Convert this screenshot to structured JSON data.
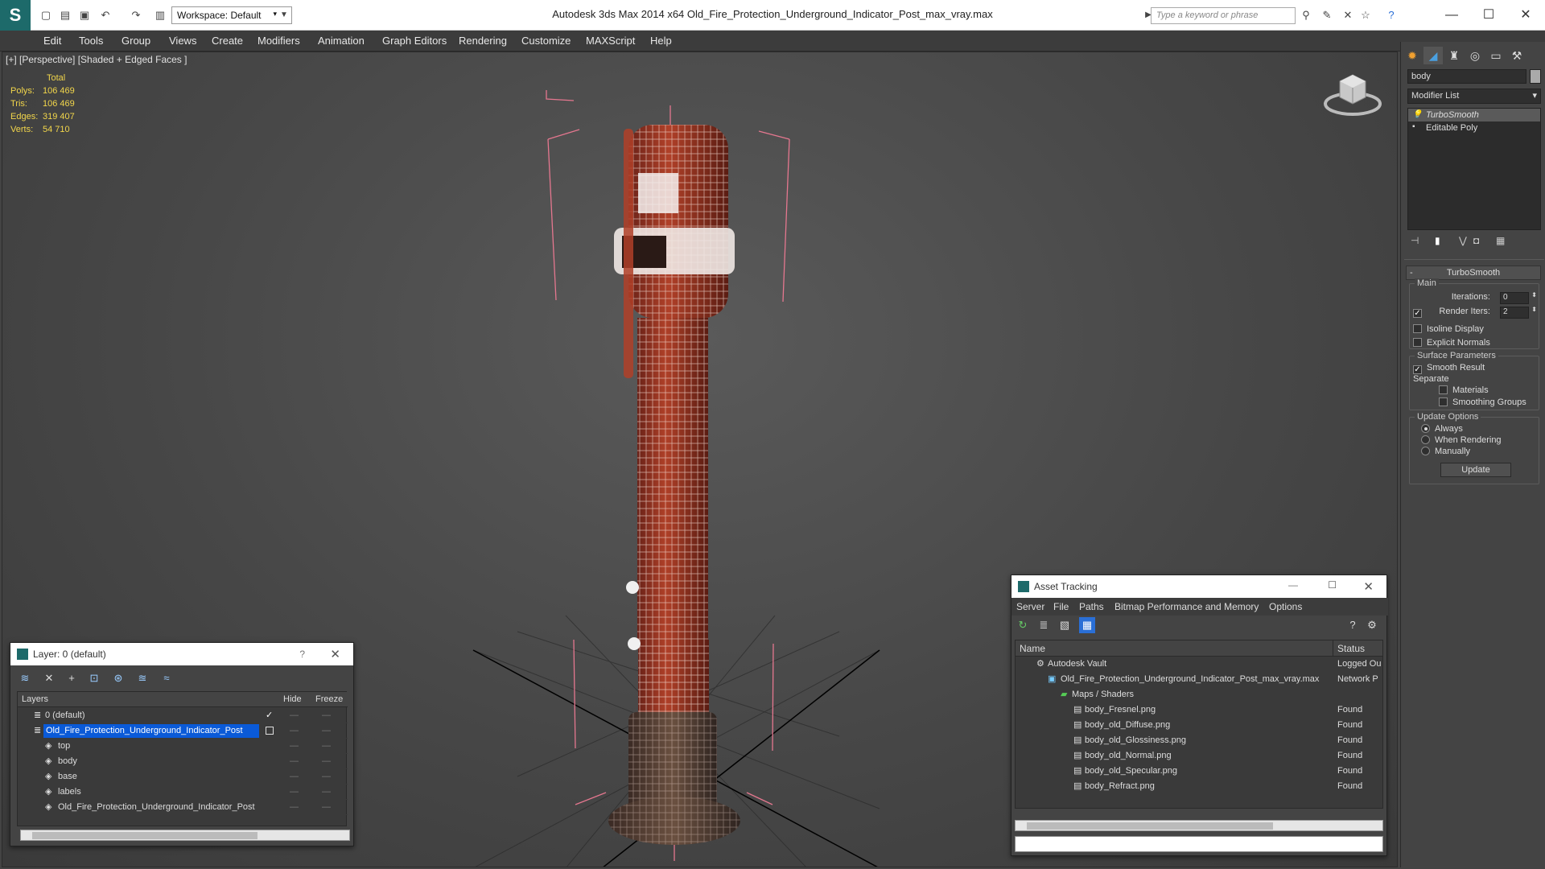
{
  "titlebar": {
    "app_title": "Autodesk 3ds Max  2014 x64      Old_Fire_Protection_Underground_Indicator_Post_max_vray.max",
    "workspace": "Workspace: Default",
    "search_placeholder": "Type a keyword or phrase"
  },
  "menu": [
    "Edit",
    "Tools",
    "Group",
    "Views",
    "Create",
    "Modifiers",
    "Animation",
    "Graph Editors",
    "Rendering",
    "Customize",
    "MAXScript",
    "Help"
  ],
  "viewport": {
    "label": "[+] [Perspective] [Shaded + Edged Faces ]",
    "stats": {
      "total": "Total",
      "rows": [
        {
          "label": "Polys:",
          "value": "106 469"
        },
        {
          "label": "Tris:",
          "value": "106 469"
        },
        {
          "label": "Edges:",
          "value": "319 407"
        },
        {
          "label": "Verts:",
          "value": "54 710"
        }
      ]
    }
  },
  "command_panel": {
    "object_name": "body",
    "modifier_list": "Modifier List",
    "stack": [
      "TurboSmooth",
      "Editable Poly"
    ],
    "rollout_title": "TurboSmooth",
    "main_group": "Main",
    "iterations_label": "Iterations:",
    "iterations_value": "0",
    "render_iters_label": "Render Iters:",
    "render_iters_value": "2",
    "isoline": "Isoline Display",
    "explicit_normals": "Explicit Normals",
    "surface_group": "Surface Parameters",
    "smooth_result": "Smooth Result",
    "separate": "Separate",
    "materials": "Materials",
    "smoothing_groups": "Smoothing Groups",
    "update_group": "Update Options",
    "always": "Always",
    "when_rendering": "When Rendering",
    "manually": "Manually",
    "update_button": "Update"
  },
  "layer_window": {
    "title": "Layer: 0 (default)",
    "col_layers": "Layers",
    "col_hide": "Hide",
    "col_freeze": "Freeze",
    "rows": [
      {
        "name": "0 (default)",
        "indent": 0,
        "selected": false
      },
      {
        "name": "Old_Fire_Protection_Underground_Indicator_Post",
        "indent": 0,
        "selected": true
      },
      {
        "name": "top",
        "indent": 1,
        "selected": false
      },
      {
        "name": "body",
        "indent": 1,
        "selected": false
      },
      {
        "name": "base",
        "indent": 1,
        "selected": false
      },
      {
        "name": "labels",
        "indent": 1,
        "selected": false
      },
      {
        "name": "Old_Fire_Protection_Underground_Indicator_Post",
        "indent": 1,
        "selected": false
      }
    ]
  },
  "asset_window": {
    "title": "Asset Tracking",
    "menu": [
      "Server",
      "File",
      "Paths",
      "Bitmap Performance and Memory",
      "Options"
    ],
    "col_name": "Name",
    "col_status": "Status",
    "rows": [
      {
        "name": "Autodesk Vault",
        "status": "Logged Ou",
        "indent": 1
      },
      {
        "name": "Old_Fire_Protection_Underground_Indicator_Post_max_vray.max",
        "status": "Network P",
        "indent": 2
      },
      {
        "name": "Maps / Shaders",
        "status": "",
        "indent": 3
      },
      {
        "name": "body_Fresnel.png",
        "status": "Found",
        "indent": 4
      },
      {
        "name": "body_old_Diffuse.png",
        "status": "Found",
        "indent": 4
      },
      {
        "name": "body_old_Glossiness.png",
        "status": "Found",
        "indent": 4
      },
      {
        "name": "body_old_Normal.png",
        "status": "Found",
        "indent": 4
      },
      {
        "name": "body_old_Specular.png",
        "status": "Found",
        "indent": 4
      },
      {
        "name": "body_Refract.png",
        "status": "Found",
        "indent": 4
      }
    ]
  }
}
